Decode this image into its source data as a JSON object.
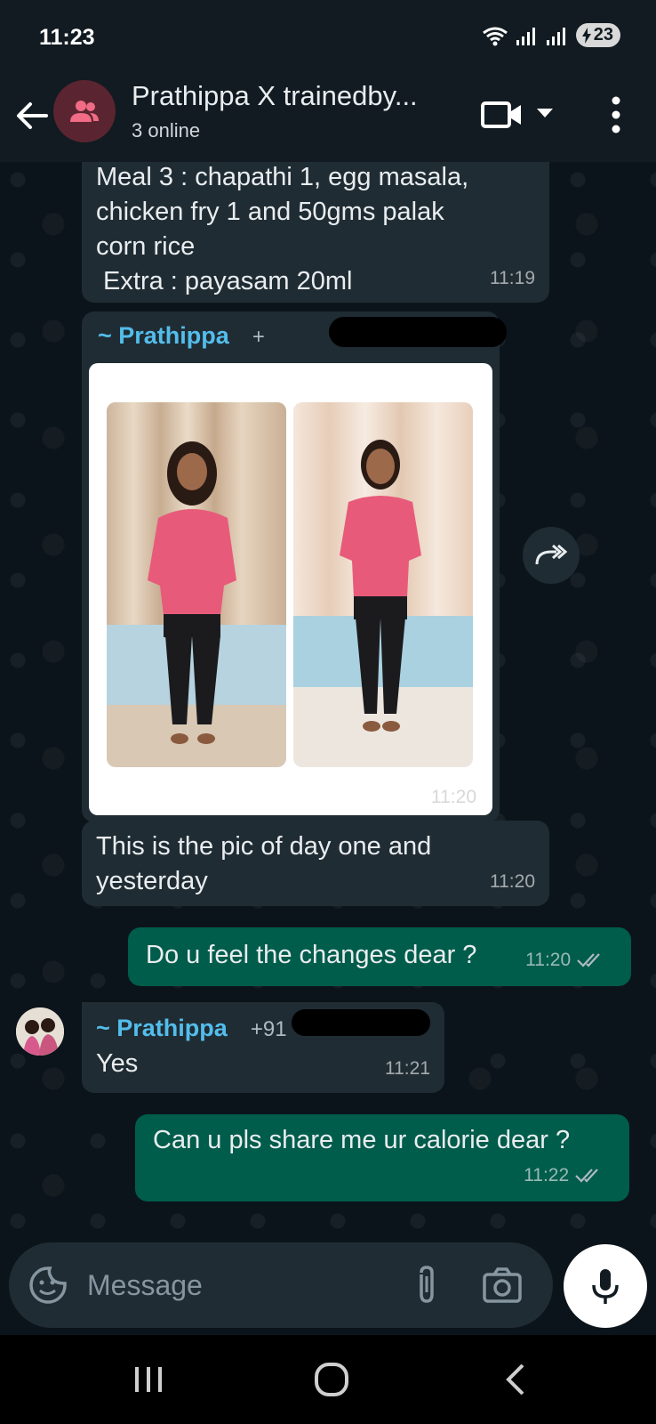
{
  "status_bar": {
    "time": "11:23",
    "battery": "23"
  },
  "header": {
    "title": "Prathippa X trainedby...",
    "subtitle": "3 online"
  },
  "messages": [
    {
      "id": "m1",
      "direction": "incoming",
      "lines": [
        "Meal 3 : chapathi 1, egg masala,",
        "chicken fry 1 and 50gms palak",
        "corn rice",
        " Extra : payasam 20ml"
      ],
      "time": "11:19"
    },
    {
      "id": "m2",
      "direction": "incoming",
      "type": "image",
      "sender": "~ Prathippa",
      "sender_phone": "+",
      "time": "11:20"
    },
    {
      "id": "m3",
      "direction": "incoming",
      "lines": [
        "This is the pic of day one and",
        "yesterday"
      ],
      "time": "11:20"
    },
    {
      "id": "m4",
      "direction": "outgoing",
      "text": "Do u feel the changes dear ?",
      "time": "11:20"
    },
    {
      "id": "m5",
      "direction": "incoming",
      "sender": "~ Prathippa",
      "sender_phone": "+91",
      "text": "Yes",
      "time": "11:21"
    },
    {
      "id": "m6",
      "direction": "outgoing",
      "text": "Can u pls share me ur calorie dear ?",
      "time": "11:22"
    }
  ],
  "composer": {
    "placeholder": "Message"
  },
  "colors": {
    "background": "#0b141a",
    "header": "#111b21",
    "incoming_bubble": "#202c33",
    "outgoing_bubble": "#005c4b",
    "sender_name": "#53bdeb"
  }
}
